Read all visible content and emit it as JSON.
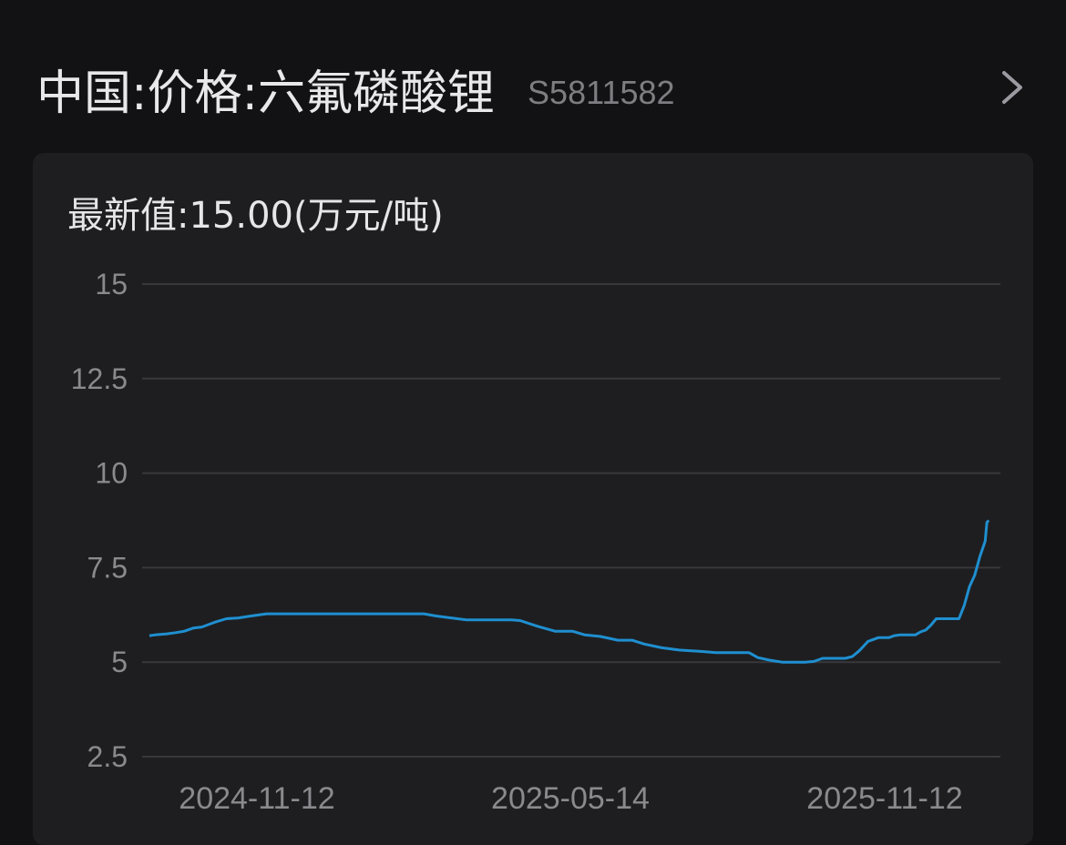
{
  "header": {
    "title": "中国:价格:六氟磷酸锂",
    "code": "S5811582",
    "chevron_icon": "chevron-right-icon"
  },
  "card": {
    "latest_label": "最新值:15.00(万元/吨)"
  },
  "colors": {
    "line": "#1f8fd0",
    "grid": "#38383c",
    "background": "#121214",
    "card": "#1e1e20"
  },
  "chart_data": {
    "type": "line",
    "title": "",
    "xlabel": "",
    "ylabel": "",
    "ylim": [
      2.5,
      15
    ],
    "y_ticks": [
      "15",
      "12.5",
      "10",
      "7.5",
      "5",
      "2.5"
    ],
    "x_tick_labels": [
      "2024-11-12",
      "2025-05-14",
      "2025-11-12"
    ],
    "x_range": [
      "2024-09-25",
      "2026-01-20"
    ],
    "grid": true,
    "series": [
      {
        "name": "",
        "x": [
          "2024-09-25",
          "2024-09-28",
          "2024-10-05",
          "2024-10-10",
          "2024-10-15",
          "2024-10-20",
          "2024-10-25",
          "2024-11-01",
          "2024-11-08",
          "2024-11-15",
          "2024-11-22",
          "2024-12-01",
          "2024-12-10",
          "2024-12-20",
          "2025-01-01",
          "2025-01-15",
          "2025-02-01",
          "2025-02-15",
          "2025-03-01",
          "2025-03-08",
          "2025-03-15",
          "2025-03-25",
          "2025-04-05",
          "2025-04-15",
          "2025-04-20",
          "2025-04-25",
          "2025-05-05",
          "2025-05-15",
          "2025-05-25",
          "2025-06-01",
          "2025-06-10",
          "2025-06-20",
          "2025-06-28",
          "2025-07-05",
          "2025-07-15",
          "2025-07-25",
          "2025-08-01",
          "2025-08-08",
          "2025-08-15",
          "2025-08-22",
          "2025-08-29",
          "2025-09-03",
          "2025-09-08",
          "2025-09-15",
          "2025-09-22",
          "2025-09-29",
          "2025-10-05",
          "2025-10-10",
          "2025-10-15",
          "2025-10-20",
          "2025-10-25",
          "2025-10-28",
          "2025-11-01",
          "2025-11-05",
          "2025-11-08",
          "2025-11-10",
          "2025-11-13",
          "2025-11-16",
          "2025-11-18",
          "2025-11-20",
          "2025-11-22",
          "2025-11-25",
          "2025-11-28",
          "2025-12-01",
          "2025-12-04",
          "2025-12-07",
          "2025-12-10",
          "2025-12-13",
          "2025-12-16",
          "2025-12-19",
          "2025-12-22",
          "2025-12-25",
          "2025-12-28",
          "2026-01-01",
          "2026-01-04",
          "2026-01-07",
          "2026-01-10",
          "2026-01-13",
          "2026-01-16",
          "2026-01-17",
          "2026-01-18"
        ],
        "y": [
          5.7,
          5.72,
          5.75,
          5.78,
          5.82,
          5.9,
          5.93,
          6.05,
          6.15,
          6.17,
          6.22,
          6.28,
          6.28,
          6.28,
          6.28,
          6.28,
          6.28,
          6.28,
          6.28,
          6.22,
          6.18,
          6.12,
          6.12,
          6.12,
          6.12,
          6.1,
          5.95,
          5.82,
          5.82,
          5.72,
          5.68,
          5.58,
          5.58,
          5.48,
          5.38,
          5.32,
          5.3,
          5.28,
          5.25,
          5.25,
          5.25,
          5.25,
          5.12,
          5.05,
          5.0,
          5.0,
          5.0,
          5.02,
          5.1,
          5.1,
          5.1,
          5.1,
          5.15,
          5.3,
          5.45,
          5.55,
          5.6,
          5.65,
          5.65,
          5.65,
          5.65,
          5.7,
          5.72,
          5.72,
          5.72,
          5.72,
          5.8,
          5.85,
          5.98,
          6.15,
          6.15,
          6.15,
          6.15,
          6.15,
          6.5,
          7.0,
          7.3,
          7.8,
          8.2,
          8.7,
          8.75
        ]
      }
    ]
  }
}
